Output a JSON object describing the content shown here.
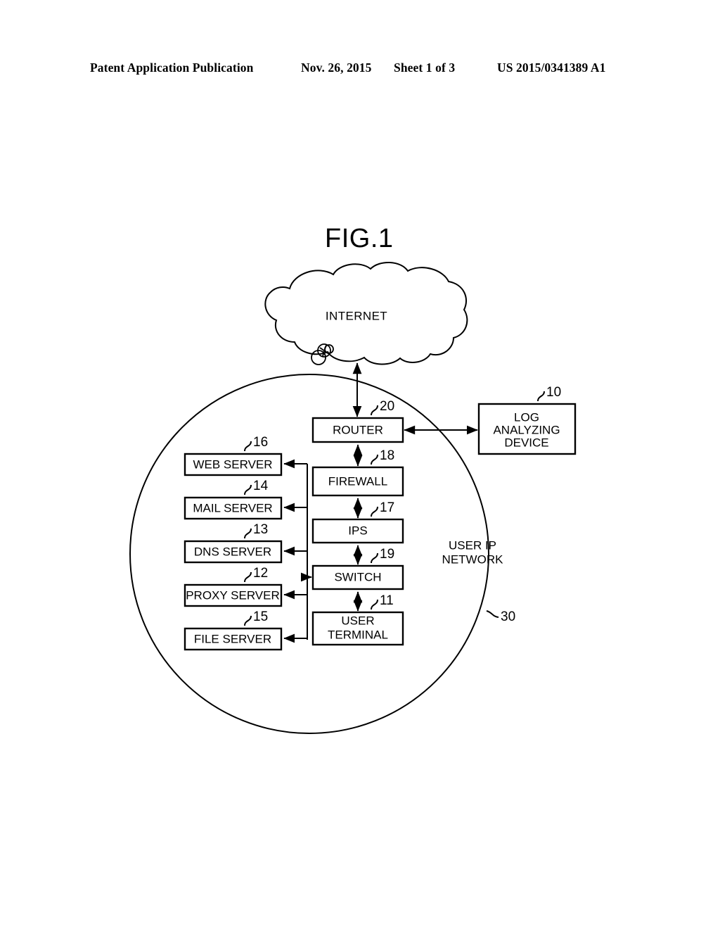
{
  "header": {
    "title": "Patent Application Publication",
    "date": "Nov. 26, 2015",
    "sheet": "Sheet 1 of 3",
    "number": "US 2015/0341389 A1"
  },
  "figure": {
    "title": "FIG.1",
    "cloud_label": "INTERNET",
    "network_label_line1": "USER IP",
    "network_label_line2": "NETWORK",
    "network_ref": "30"
  },
  "blocks": [
    {
      "id": "router",
      "label": "ROUTER",
      "ref": "20"
    },
    {
      "id": "firewall",
      "label": "FIREWALL",
      "ref": "18"
    },
    {
      "id": "ips",
      "label": "IPS",
      "ref": "17"
    },
    {
      "id": "switch",
      "label": "SWITCH",
      "ref": "19"
    },
    {
      "id": "user-terminal",
      "label_line1": "USER",
      "label_line2": "TERMINAL",
      "ref": "11"
    },
    {
      "id": "web-server",
      "label": "WEB SERVER",
      "ref": "16"
    },
    {
      "id": "mail-server",
      "label": "MAIL SERVER",
      "ref": "14"
    },
    {
      "id": "dns-server",
      "label": "DNS SERVER",
      "ref": "13"
    },
    {
      "id": "proxy-server",
      "label": "PROXY SERVER",
      "ref": "12"
    },
    {
      "id": "file-server",
      "label": "FILE SERVER",
      "ref": "15"
    },
    {
      "id": "log-analyzing-device",
      "label_line1": "LOG",
      "label_line2": "ANALYZING",
      "label_line3": "DEVICE",
      "ref": "10"
    }
  ],
  "colors": {
    "ink": "#000000",
    "paper": "#ffffff"
  }
}
